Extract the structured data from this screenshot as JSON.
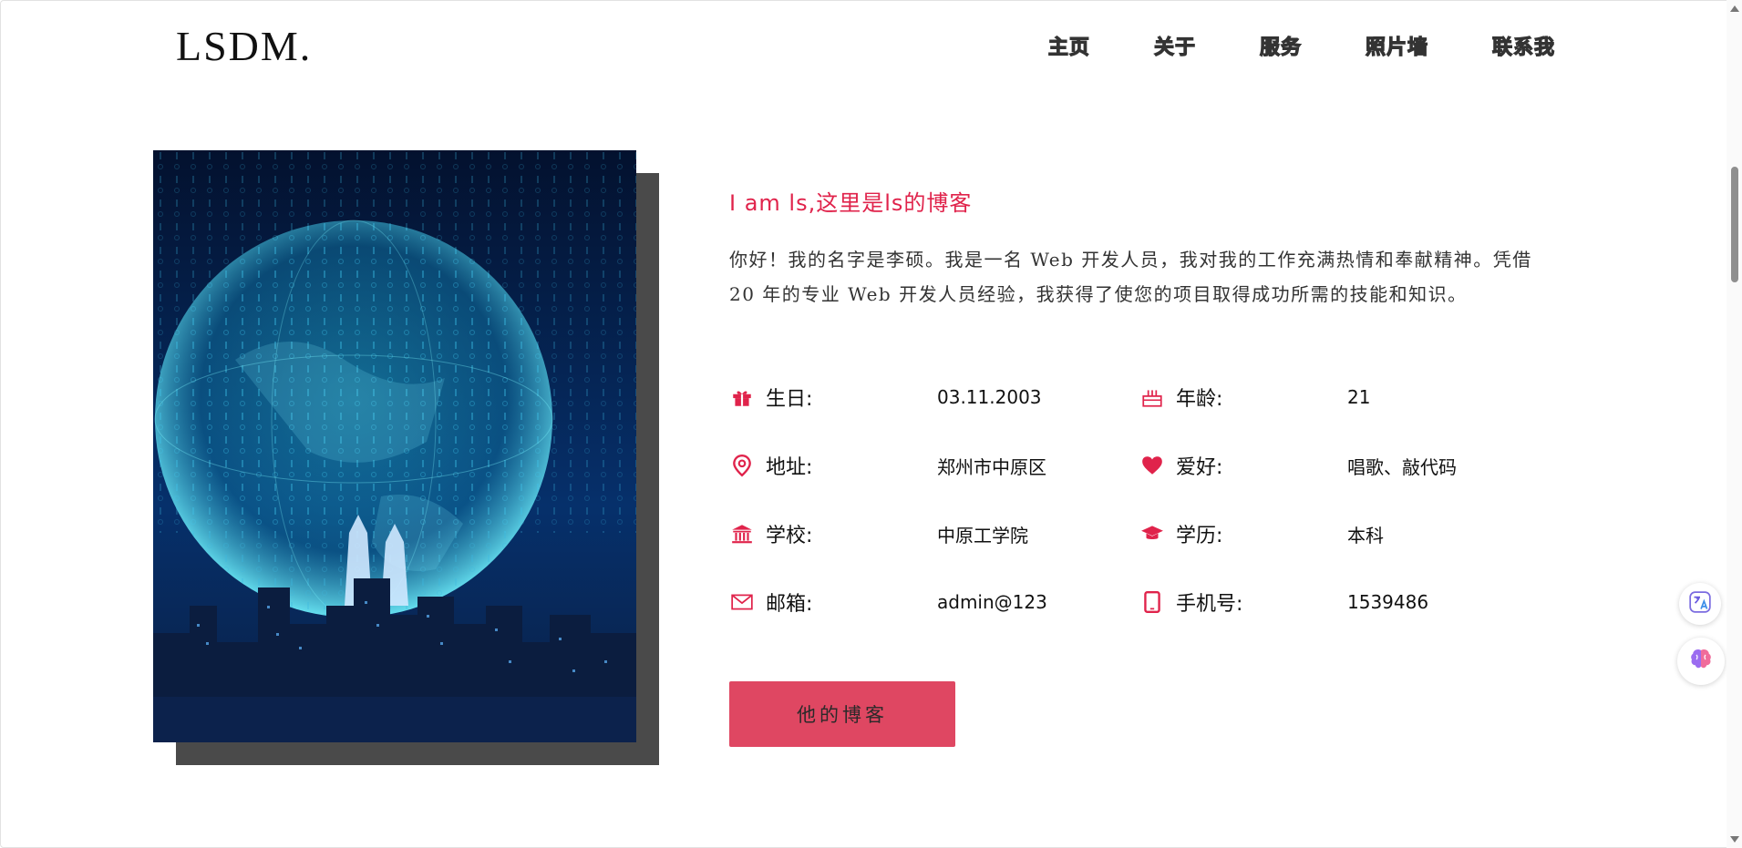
{
  "header": {
    "logo": "LSDM.",
    "nav": [
      "主页",
      "关于",
      "服务",
      "照片墙",
      "联系我"
    ]
  },
  "hero_image": {
    "alt": "digital globe over city skyline"
  },
  "about": {
    "subtitle": "I am ls,这里是ls的博客",
    "intro": "你好！我的名字是李硕。我是一名 Web 开发人员，我对我的工作充满热情和奉献精神。凭借 20 年的专业 Web 开发人员经验，我获得了使您的项目取得成功所需的技能和知识。",
    "info": [
      {
        "icon": "gift-icon",
        "label": "生日:",
        "value": "03.11.2003"
      },
      {
        "icon": "cake-icon",
        "label": "年龄:",
        "value": "21"
      },
      {
        "icon": "location-pin-icon",
        "label": "地址:",
        "value": "郑州市中原区"
      },
      {
        "icon": "heart-icon",
        "label": "爱好:",
        "value": "唱歌、敲代码"
      },
      {
        "icon": "school-building-icon",
        "label": "学校:",
        "value": "中原工学院"
      },
      {
        "icon": "graduation-cap-icon",
        "label": "学历:",
        "value": "本科"
      },
      {
        "icon": "envelope-icon",
        "label": "邮箱:",
        "value": "admin@123"
      },
      {
        "icon": "mobile-phone-icon",
        "label": "手机号:",
        "value": "1539486"
      }
    ],
    "button_label": "他的博客"
  },
  "colors": {
    "accent": "#e0234b",
    "button": "#df4762",
    "shadow": "#4a4a4a"
  }
}
